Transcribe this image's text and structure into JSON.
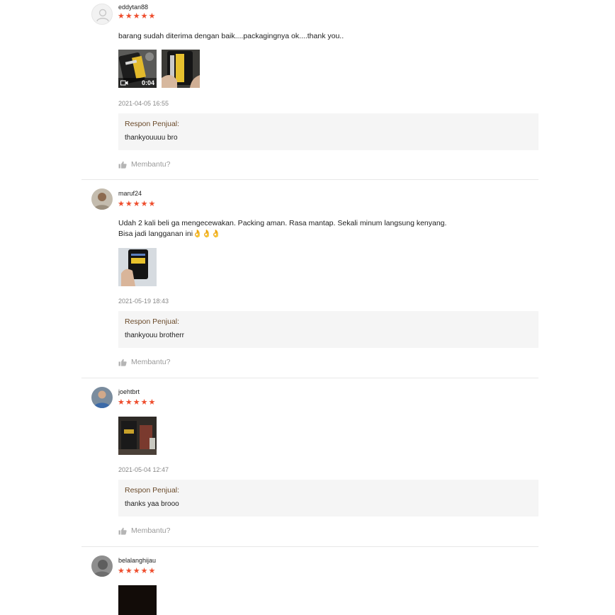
{
  "reviews": [
    {
      "username": "eddytan88",
      "rating": 5,
      "comment_lines": [
        "barang sudah diterima dengan baik....packagingnya ok....thank you.."
      ],
      "video_duration": "0:04",
      "timestamp": "2021-04-05 16:55",
      "response_title": "Respon Penjual:",
      "response_text": "thankyouuuu bro",
      "helpful_label": "Membantu?"
    },
    {
      "username": "maruf24",
      "rating": 5,
      "comment_lines": [
        "Udah 2 kali beli ga mengecewakan. Packing aman. Rasa mantap. Sekali minum langsung kenyang.",
        "Bisa jadi langganan ini👌👌👌"
      ],
      "timestamp": "2021-05-19 18:43",
      "response_title": "Respon Penjual:",
      "response_text": "thankyouu brotherr",
      "helpful_label": "Membantu?"
    },
    {
      "username": "joehtbrt",
      "rating": 5,
      "timestamp": "2021-05-04 12:47",
      "response_title": "Respon Penjual:",
      "response_text": "thanks yaa brooo",
      "helpful_label": "Membantu?"
    },
    {
      "username": "belalanghijau",
      "rating": 5
    }
  ],
  "colors": {
    "star": "#ee4d2d",
    "response_bg": "#f5f5f5",
    "response_title": "#6a4a2a",
    "muted": "#888888"
  },
  "icons": {
    "rating": "star-icon",
    "helpful": "thumb-up-icon",
    "default_avatar": "user-silhouette-icon",
    "video": "video-camera-icon"
  }
}
